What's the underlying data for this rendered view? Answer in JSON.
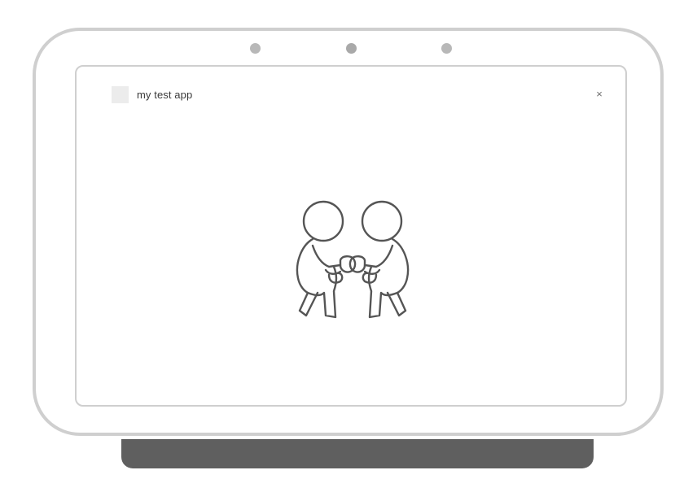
{
  "app": {
    "title": "my test app",
    "close_label": "×"
  },
  "icons": {
    "app_icon": "app-placeholder-icon",
    "close": "close-icon",
    "illustration": "fist-bump-illustration"
  },
  "colors": {
    "frame": "#cfcfcf",
    "stand": "#5f5f5f",
    "title_text": "#3a3a3a"
  }
}
